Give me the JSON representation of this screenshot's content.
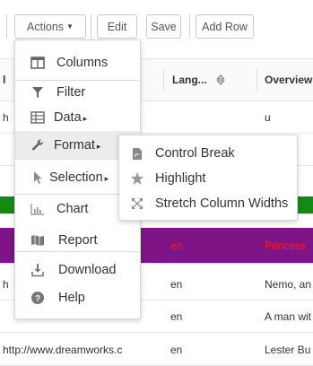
{
  "toolbar": {
    "actions_label": "Actions",
    "edit_label": "Edit",
    "save_label": "Save",
    "add_row_label": "Add Row"
  },
  "grid": {
    "headers": [
      {
        "label": "l"
      },
      {
        "label": "Lang...",
        "sort_icon": "sort-icon"
      },
      {
        "label": "Overview"
      }
    ],
    "rows": [
      {
        "first": "h",
        "lang": "",
        "overview": "u",
        "bg": "#ffffff",
        "color": "#333333"
      },
      {
        "first": "",
        "lang": "",
        "overview": "it",
        "bg": "#ffffff",
        "color": "#333333"
      },
      {
        "first": "",
        "lang": "",
        "overview": "n",
        "bg": "#138a13",
        "color": "#ffffff"
      },
      {
        "first": "",
        "lang": "en",
        "overview": "Princess",
        "bg": "#7f1487",
        "color": "#ff1c1c"
      },
      {
        "first": "h",
        "lang": "en",
        "overview": "Nemo, an",
        "bg": "#ffffff",
        "color": "#333333"
      },
      {
        "first": "",
        "lang": "en",
        "overview": "A man wit",
        "bg": "#ffffff",
        "color": "#333333"
      },
      {
        "first": "http://www.dreamworks.c",
        "lang": "en",
        "overview": "Lester Bu",
        "bg": "#ffffff",
        "color": "#333333"
      }
    ]
  },
  "menu": {
    "items": [
      {
        "label": "Columns",
        "icon": "columns-icon",
        "submenu": false
      },
      {
        "label": "Filter",
        "icon": "filter-icon",
        "submenu": false
      },
      {
        "label": "Data",
        "icon": "data-table-icon",
        "submenu": true
      },
      {
        "label": "Format",
        "icon": "wrench-icon",
        "submenu": true,
        "active": true
      },
      {
        "label": "Selection",
        "icon": "cursor-icon",
        "submenu": true
      },
      {
        "label": "Chart",
        "icon": "chart-icon",
        "submenu": false
      },
      {
        "label": "Report",
        "icon": "report-map-icon",
        "submenu": false
      },
      {
        "label": "Download",
        "icon": "download-icon",
        "submenu": false
      },
      {
        "label": "Help",
        "icon": "help-icon",
        "submenu": false
      }
    ]
  },
  "format_submenu": {
    "items": [
      {
        "label": "Control Break",
        "icon": "control-break-icon"
      },
      {
        "label": "Highlight",
        "icon": "star-icon"
      },
      {
        "label": "Stretch Column Widths",
        "icon": "stretch-icon"
      }
    ]
  }
}
